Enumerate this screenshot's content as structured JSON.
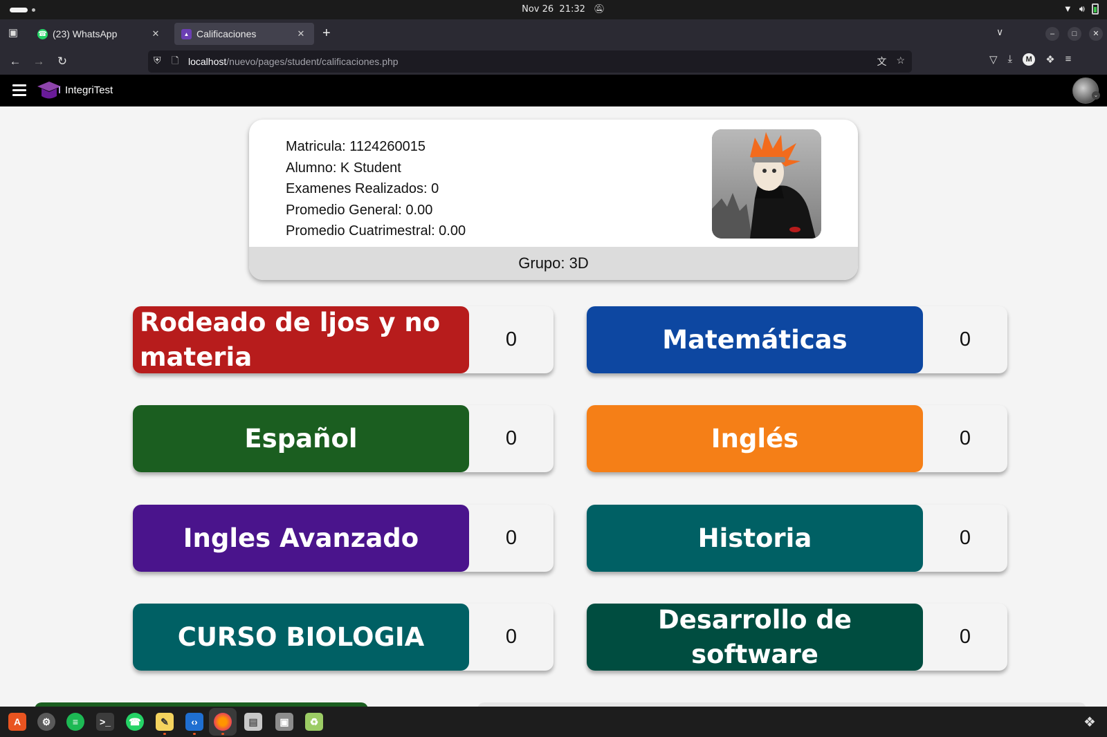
{
  "os": {
    "date": "Nov 26",
    "time": "21:32"
  },
  "browser": {
    "tabs": [
      {
        "title": "(23) WhatsApp",
        "favicon": "whatsapp-icon",
        "active": false
      },
      {
        "title": "Calificaciones",
        "favicon": "calificaciones-favicon",
        "active": true
      }
    ],
    "url_host": "localhost",
    "url_path": "/nuevo/pages/student/calificaciones.php"
  },
  "app": {
    "brand": "IntegriTest"
  },
  "student": {
    "matricula": "Matricula: 1124260015",
    "alumno": "Alumno: K Student",
    "examenes": "Examenes Realizados: 0",
    "promedio_general": "Promedio General: 0.00",
    "promedio_cuatrimestral": "Promedio Cuatrimestral: 0.00",
    "grupo": "Grupo: 3D"
  },
  "subjects": [
    {
      "name": "Rodeado de ljos y no materia",
      "score": "0",
      "color": "#b71c1c"
    },
    {
      "name": "Matemáticas",
      "score": "0",
      "color": "#0d47a1"
    },
    {
      "name": "Español",
      "score": "0",
      "color": "#1b5e20"
    },
    {
      "name": "Inglés",
      "score": "0",
      "color": "#f57f17"
    },
    {
      "name": "Ingles Avanzado",
      "score": "0",
      "color": "#4a148c"
    },
    {
      "name": "Historia",
      "score": "0",
      "color": "#006064"
    },
    {
      "name": "CURSO BIOLOGIA",
      "score": "0",
      "color": "#006064"
    },
    {
      "name": "Desarrollo de software",
      "score": "0",
      "color": "#004d40"
    }
  ],
  "taskbar": {
    "apps": [
      "app-center-icon",
      "settings-icon",
      "spotify-icon",
      "terminal-icon",
      "whatsapp-icon",
      "text-editor-icon",
      "vscode-icon",
      "firefox-icon",
      "files-icon",
      "disk-icon",
      "trash-icon"
    ]
  }
}
